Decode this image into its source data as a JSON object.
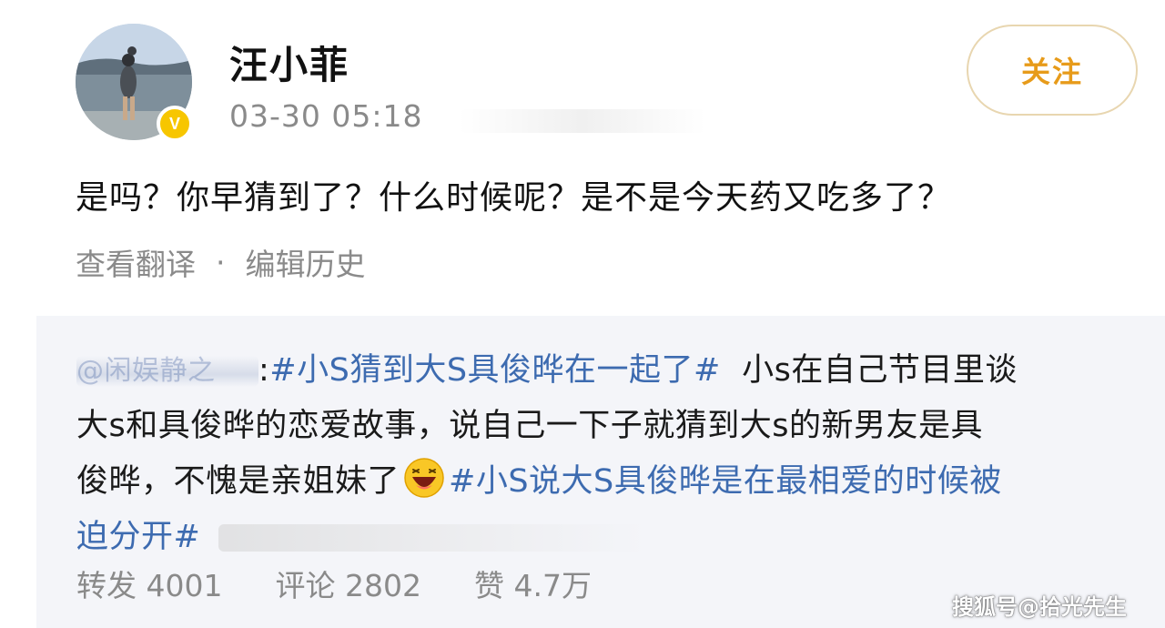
{
  "header": {
    "username": "汪小菲",
    "timestamp": "03-30 05:18",
    "follow_label": "关注",
    "verified_mark": "V"
  },
  "post": {
    "text": "是吗？你早猜到了？什么时候呢？是不是今天药又吃多了？",
    "translate_label": "查看翻译",
    "separator": "·",
    "edit_history_label": "编辑历史"
  },
  "repost": {
    "mention": "@闲娱静之",
    "colon": ":",
    "topic1": "#小S猜到大S具俊晔在一起了#",
    "line1_rest": "小s在自己节目里谈",
    "line2": "大s和具俊晔的恋爱故事，说自己一下子就猜到大s的新男友是具",
    "line3_text": "俊晔，不愧是亲姐妹了",
    "topic2_part1": "#小S说大S具俊晔是在最相爱的时候被",
    "topic2_part2": "迫分开#",
    "emoji_icon": "laughing-emoji-icon"
  },
  "stats": {
    "repost_label": "转发",
    "repost_count": "4001",
    "comment_label": "评论",
    "comment_count": "2802",
    "like_label": "赞",
    "like_count": "4.7万"
  },
  "watermark": "搜狐号@拾光先生",
  "colors": {
    "topic": "#3d6bb0",
    "follow": "#e79b1a",
    "verified": "#f7c600",
    "muted": "#8a8a8a"
  }
}
